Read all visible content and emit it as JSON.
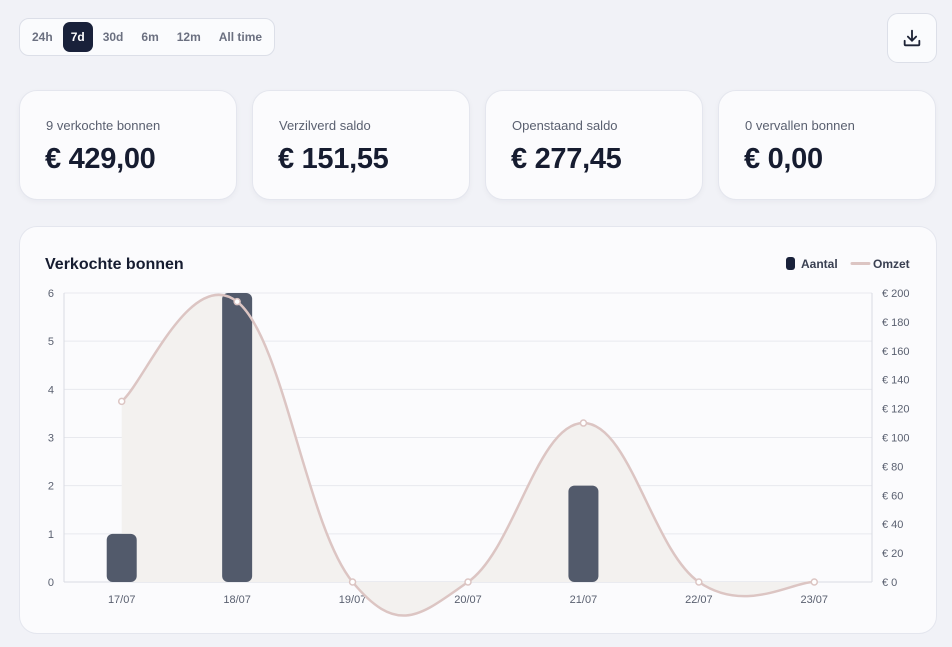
{
  "time_ranges": {
    "options": [
      "24h",
      "7d",
      "30d",
      "6m",
      "12m",
      "All time"
    ],
    "selected": "7d"
  },
  "toolbar": {
    "download_icon": "download-icon"
  },
  "stats": [
    {
      "label": "9 verkochte bonnen",
      "value": "€ 429,00"
    },
    {
      "label": "Verzilverd saldo",
      "value": "€ 151,55"
    },
    {
      "label": "Openstaand saldo",
      "value": "€ 277,45"
    },
    {
      "label": "0 vervallen bonnen",
      "value": "€ 0,00"
    }
  ],
  "colors": {
    "accent": "#19213a",
    "bar": "#525a6b",
    "line": "#dcc5c3",
    "area": "#f3f1ef"
  },
  "chart_data": {
    "type": "bar",
    "title": "Verkochte bonnen",
    "categories": [
      "17/07",
      "18/07",
      "19/07",
      "20/07",
      "21/07",
      "22/07",
      "23/07"
    ],
    "series": [
      {
        "name": "Aantal",
        "type": "bar",
        "axis": "left",
        "values": [
          1,
          6,
          0,
          0,
          2,
          0,
          0
        ]
      },
      {
        "name": "Omzet",
        "type": "line",
        "axis": "right",
        "values": [
          125,
          194,
          0,
          0,
          110,
          0,
          0
        ]
      }
    ],
    "y_left": {
      "ticks": [
        "0",
        "1",
        "2",
        "3",
        "4",
        "5",
        "6"
      ],
      "range": [
        0,
        6
      ]
    },
    "y_right": {
      "ticks": [
        "€ 0",
        "€ 20",
        "€ 40",
        "€ 60",
        "€ 80",
        "€ 100",
        "€ 120",
        "€ 140",
        "€ 160",
        "€ 180",
        "€ 200"
      ],
      "range": [
        0,
        200
      ]
    },
    "grid": true,
    "legend_position": "top-right"
  }
}
